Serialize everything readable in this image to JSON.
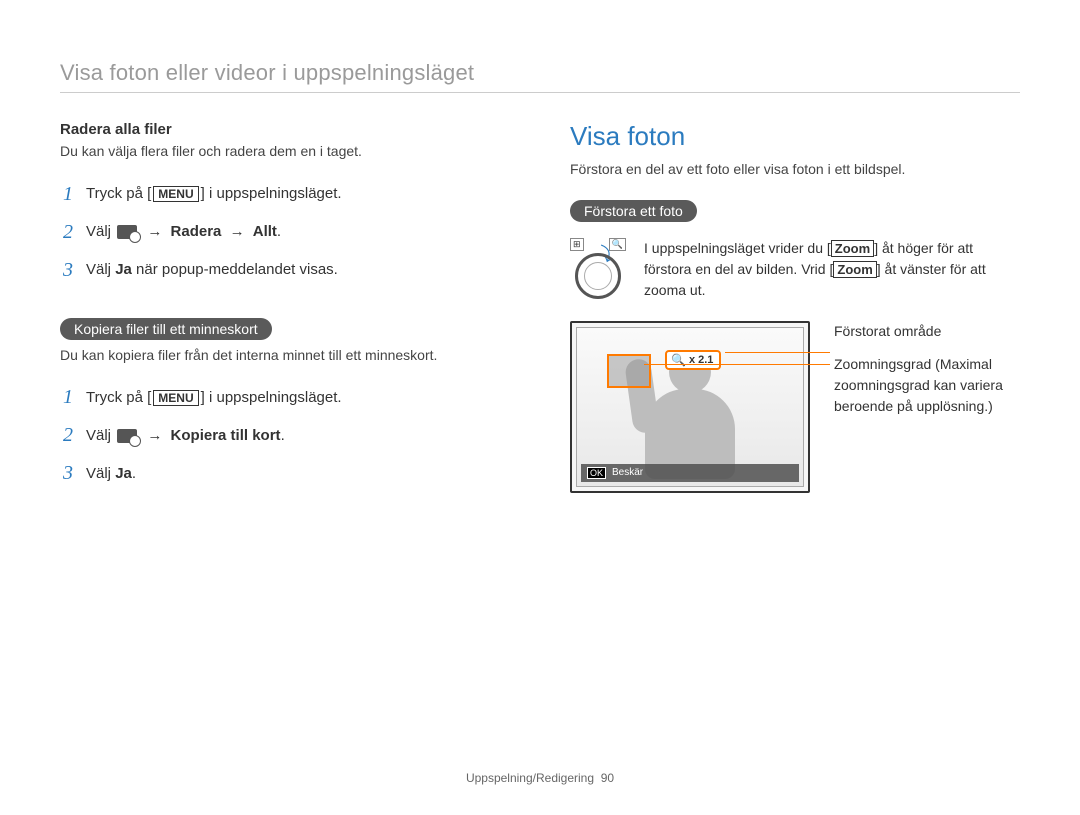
{
  "header": {
    "title": "Visa foton eller videor i uppspelningsläget"
  },
  "left": {
    "delete_all_heading": "Radera alla filer",
    "delete_all_desc": "Du kan välja flera filer och radera dem en i taget.",
    "menu_label": "MENU",
    "steps_delete": {
      "s1_pre": "Tryck på [",
      "s1_post": "] i uppspelningsläget.",
      "s2_pre": "Välj ",
      "s2_arrow": "→",
      "s2_b1": "Radera",
      "s2_b2": "Allt",
      "s2_period": ".",
      "s3_pre": "Välj ",
      "s3_bold": "Ja",
      "s3_post": " när popup-meddelandet visas."
    },
    "copy_pill": "Kopiera filer till ett minneskort",
    "copy_desc": "Du kan kopiera filer från det interna minnet till ett minneskort.",
    "steps_copy": {
      "s1_pre": "Tryck på [",
      "s1_post": "] i uppspelningsläget.",
      "s2_pre": "Välj ",
      "s2_arrow": "→",
      "s2_b1": "Kopiera till kort",
      "s2_period": ".",
      "s3_pre": "Välj ",
      "s3_bold": "Ja",
      "s3_period": "."
    }
  },
  "right": {
    "section_title": "Visa foton",
    "intro": "Förstora en del av ett foto eller visa foton i ett bildspel.",
    "magnify_pill": "Förstora ett foto",
    "dial_left_label": "⊞",
    "dial_right_label": "🔍",
    "zoom_instruction_pre": "I uppspelningsläget vrider du [",
    "zoom_label": "Zoom",
    "zoom_instruction_mid1": "] åt höger för att förstora en del av bilden. Vrid [",
    "zoom_instruction_mid2": "] åt vänster för att zooma ut.",
    "callout_area": "Förstorat område",
    "callout_zoom": "Zoomningsgrad (Maximal zoomningsgrad kan variera beroende på upplösning.)",
    "zoom_badge_value": "x 2.1",
    "ok_label": "OK",
    "trim_label": "Beskär"
  },
  "footer": {
    "section": "Uppspelning/Redigering",
    "page": "90"
  }
}
